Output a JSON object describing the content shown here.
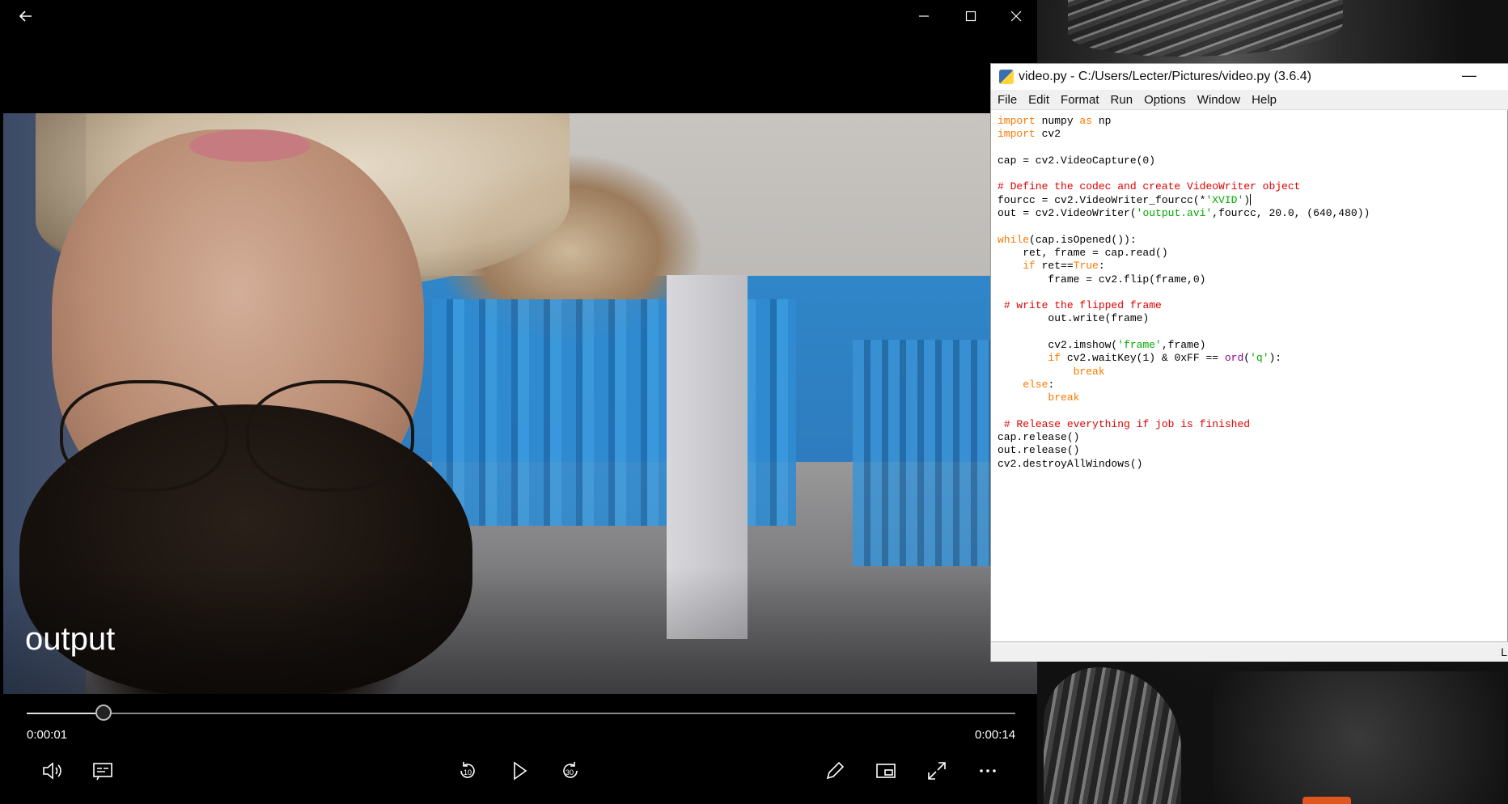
{
  "player": {
    "title": "output",
    "current_time": "0:00:01",
    "total_time": "0:00:14",
    "progress": 0.071,
    "controls": {
      "back": "back-arrow-icon",
      "minimize": "minimize-icon",
      "maximize": "maximize-icon",
      "close": "close-icon",
      "volume": "volume-icon",
      "captions": "captions-icon",
      "skip_back_label": "10",
      "play": "play-icon",
      "skip_forward_label": "30",
      "edit": "pencil-icon",
      "miniview": "mini-view-icon",
      "fullscreen": "fullscreen-icon",
      "more": "more-icon"
    }
  },
  "idle": {
    "title": "video.py - C:/Users/Lecter/Pictures/video.py (3.6.4)",
    "menu": [
      "File",
      "Edit",
      "Format",
      "Run",
      "Options",
      "Window",
      "Help"
    ],
    "status_text": "L",
    "code": [
      "import numpy as np",
      "import cv2",
      "",
      "cap = cv2.VideoCapture(0)",
      "",
      "# Define the codec and create VideoWriter object",
      "fourcc = cv2.VideoWriter_fourcc(*'XVID')",
      "out = cv2.VideoWriter('output.avi',fourcc, 20.0, (640,480))",
      "",
      "while(cap.isOpened()):",
      "    ret, frame = cap.read()",
      "    if ret==True:",
      "        frame = cv2.flip(frame,0)",
      "",
      " # write the flipped frame",
      "        out.write(frame)",
      "",
      "        cv2.imshow('frame',frame)",
      "        if cv2.waitKey(1) & 0xFF == ord('q'):",
      "            break",
      "    else:",
      "        break",
      "",
      " # Release everything if job is finished",
      "cap.release()",
      "out.release()",
      "cv2.destroyAllWindows()"
    ]
  }
}
